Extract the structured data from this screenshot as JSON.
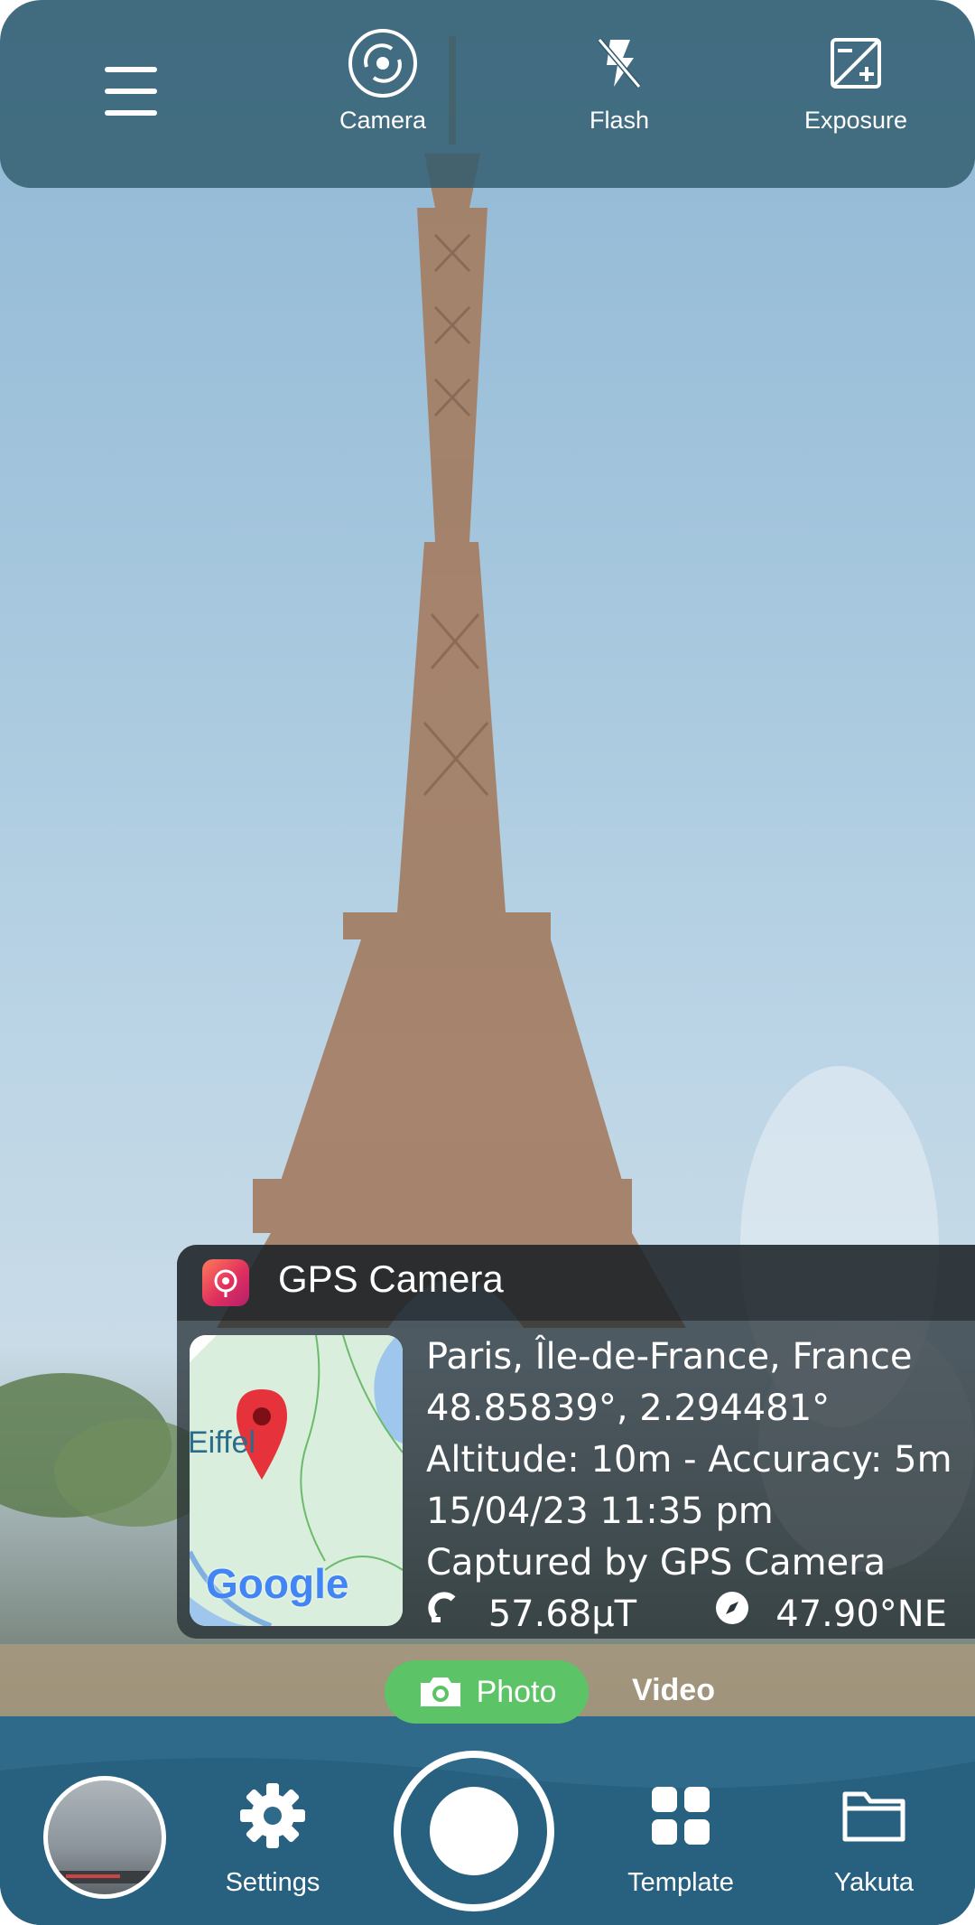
{
  "top_bar": {
    "menu_icon": "hamburger-menu-icon",
    "items": [
      {
        "label": "Camera",
        "icon": "camera-switch-icon"
      },
      {
        "label": "Flash",
        "icon": "flash-off-icon"
      },
      {
        "label": "Exposure",
        "icon": "exposure-icon"
      }
    ]
  },
  "gps_card": {
    "app_name": "GPS Camera",
    "map": {
      "place_label": "Eiffel",
      "attribution": "Google"
    },
    "address": "Paris, Île-de-France, France",
    "coordinates": "48.85839°, 2.294481°",
    "altitude_accuracy": "Altitude: 10m - Accuracy: 5m",
    "datetime": "15/04/23 11:35 pm",
    "captured_by": "Captured by GPS Camera",
    "magnetic_field": "57.68μT",
    "compass": "47.90°NE"
  },
  "modes": {
    "photo": "Photo",
    "video": "Video",
    "active": "Photo"
  },
  "bottom_bar": {
    "settings": "Settings",
    "template": "Template",
    "folder": "Yakuta"
  },
  "colors": {
    "bar": "#305c6e",
    "mode_active": "#5cc466",
    "card": "#1e282e"
  }
}
